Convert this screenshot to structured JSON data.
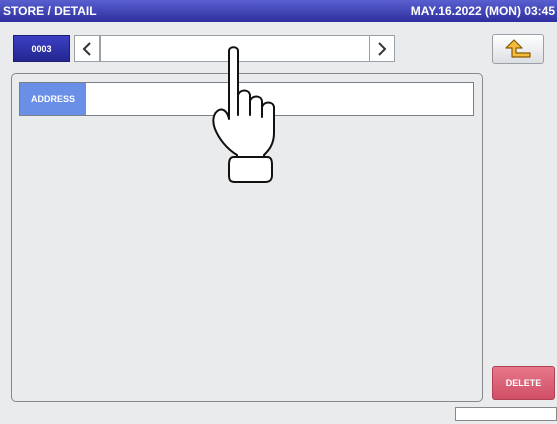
{
  "header": {
    "title": "STORE / DETAIL",
    "datetime": "MAY.16.2022 (MON) 03:45"
  },
  "record": {
    "number": "0003",
    "name_value": ""
  },
  "form": {
    "address_label": "ADDRESS",
    "address_value": ""
  },
  "actions": {
    "delete_label": "DELETE"
  },
  "icons": {
    "prev": "chevron-left-icon",
    "next": "chevron-right-icon",
    "back": "return-arrow-icon",
    "pointer": "tap-hand-icon"
  },
  "colors": {
    "titlebar": "#2c2f9c",
    "record_badge": "#2a2ea8",
    "address_label": "#6a8fe6",
    "delete": "#d8586e",
    "back_arrow": "#d79a20"
  }
}
